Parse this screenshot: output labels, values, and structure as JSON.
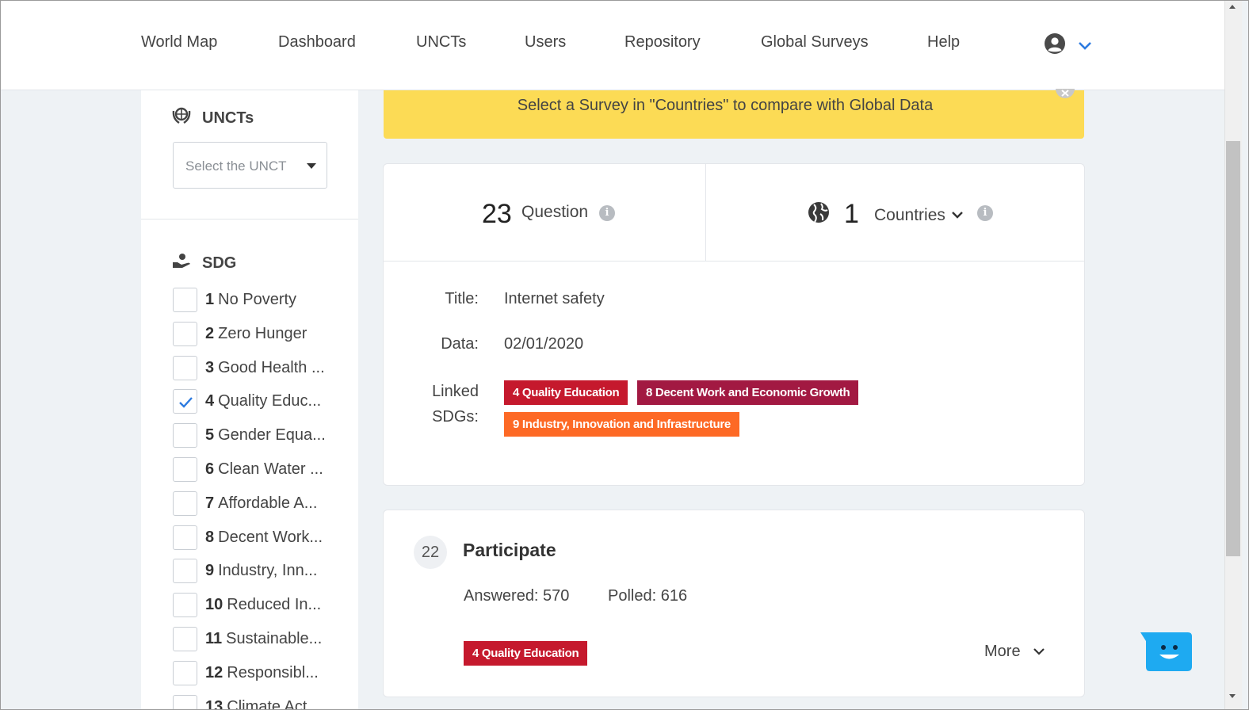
{
  "nav": {
    "items": [
      "World Map",
      "Dashboard",
      "UNCTs",
      "Users",
      "Repository",
      "Global Surveys",
      "Help"
    ],
    "user_icon": "user-circle-icon",
    "user_menu_icon": "chevron-down-icon"
  },
  "sidebar": {
    "uncts_heading": "UNCTs",
    "unct_select_placeholder": "Select the UNCT",
    "sdg_heading": "SDG",
    "sdgs": [
      {
        "num": "1",
        "label": "No Poverty",
        "checked": false
      },
      {
        "num": "2",
        "label": "Zero Hunger",
        "checked": false
      },
      {
        "num": "3",
        "label": "Good Health ...",
        "checked": false
      },
      {
        "num": "4",
        "label": "Quality Educ...",
        "checked": true
      },
      {
        "num": "5",
        "label": "Gender Equa...",
        "checked": false
      },
      {
        "num": "6",
        "label": "Clean Water ...",
        "checked": false
      },
      {
        "num": "7",
        "label": "Affordable A...",
        "checked": false
      },
      {
        "num": "8",
        "label": "Decent Work...",
        "checked": false
      },
      {
        "num": "9",
        "label": "Industry, Inn...",
        "checked": false
      },
      {
        "num": "10",
        "label": "Reduced In...",
        "checked": false
      },
      {
        "num": "11",
        "label": "Sustainable...",
        "checked": false
      },
      {
        "num": "12",
        "label": "Responsibl...",
        "checked": false
      },
      {
        "num": "13",
        "label": "Climate Act...",
        "checked": false
      }
    ]
  },
  "banner": {
    "text": "Select a Survey in \"Countries\" to compare with Global Data",
    "close_icon": "close-icon"
  },
  "stats": {
    "questions_count": "23",
    "questions_label": "Question",
    "countries_count": "1",
    "countries_label": "Countries",
    "info_glyph": "i"
  },
  "survey": {
    "title_label": "Title:",
    "title_value": "Internet safety",
    "date_label": "Data:",
    "date_value": "02/01/2020",
    "linked_label_1": "Linked",
    "linked_label_2": "SDGs:",
    "linked_sdgs": [
      {
        "label": "4 Quality Education",
        "color": "#c5192d"
      },
      {
        "label": "8 Decent Work and Economic Growth",
        "color": "#a21942"
      },
      {
        "label": "9 Industry, Innovation and Infrastructure",
        "color": "#fd6925"
      }
    ]
  },
  "question": {
    "number": "22",
    "title": "Participate",
    "answered": "Answered: 570",
    "polled": "Polled: 616",
    "tag_label": "4 Quality Education",
    "tag_color": "#c5192d",
    "more_label": "More"
  },
  "colors": {
    "accent_blue": "#2d7be0",
    "banner_yellow": "#fcdb55",
    "chat_blue": "#1eaaf1"
  }
}
